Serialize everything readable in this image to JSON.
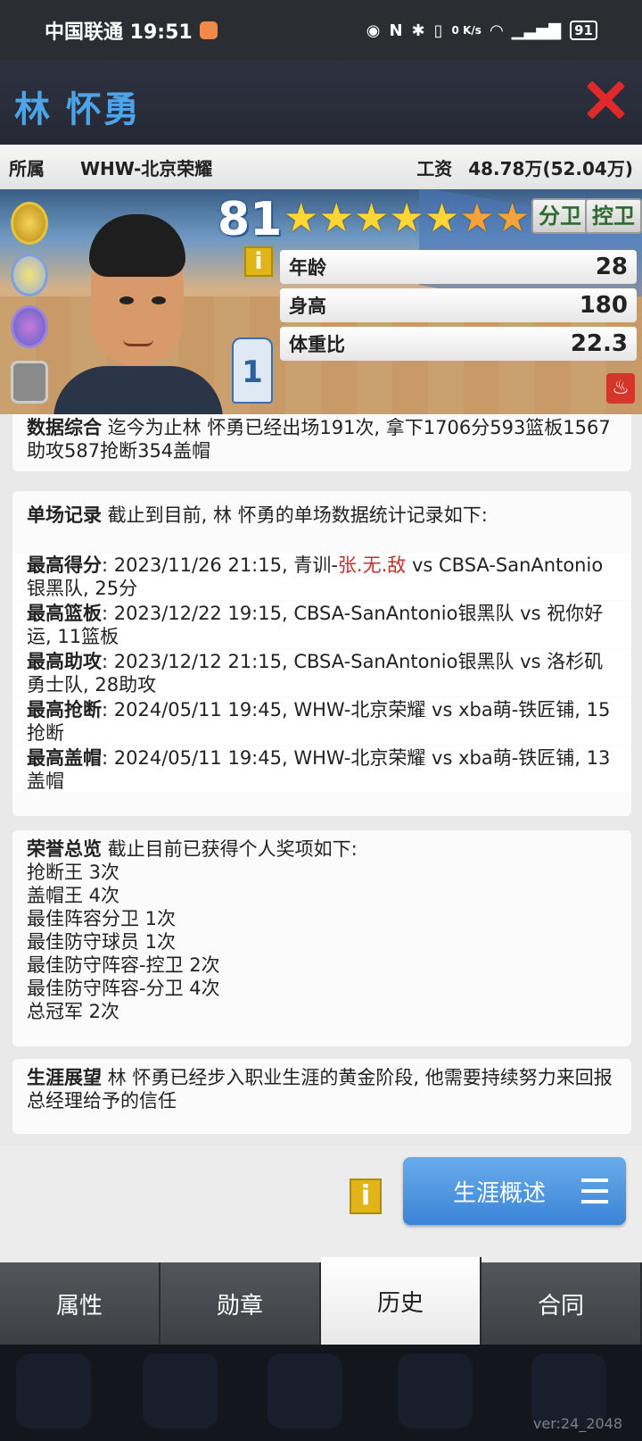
{
  "status_bar": {
    "carrier_time": "中国联通 19:51",
    "net_speed": "0 K/s",
    "battery": "91"
  },
  "header": {
    "player_name": "林 怀勇"
  },
  "team_row": {
    "team_label": "所属",
    "team": "WHW-北京荣耀",
    "salary_label": "工资",
    "salary": "48.78万(52.04万)"
  },
  "hero": {
    "rating": "81",
    "stars": [
      {
        "glyph": "★",
        "color": "gold"
      },
      {
        "glyph": "★",
        "color": "gold"
      },
      {
        "glyph": "★",
        "color": "gold"
      },
      {
        "glyph": "★",
        "color": "gold"
      },
      {
        "glyph": "★",
        "color": "gold"
      },
      {
        "glyph": "★",
        "color": "orange"
      },
      {
        "glyph": "★",
        "color": "orange"
      },
      {
        "glyph": "★",
        "color": "orange"
      }
    ],
    "positions": [
      "分卫",
      "控卫"
    ],
    "info_icon": "i",
    "jersey_number": "1",
    "attributes": [
      {
        "label": "年龄",
        "value": "28"
      },
      {
        "label": "身高",
        "value": "180"
      },
      {
        "label": "体重比",
        "value": "22.3"
      }
    ]
  },
  "summary": {
    "title": "数据综合",
    "text": " 迄今为止林 怀勇已经出场191次, 拿下1706分593篮板1567助攻587抢断354盖帽"
  },
  "records": {
    "title": "单场记录",
    "intro": " 截止到目前, 林 怀勇的单场数据统计记录如下:",
    "items": [
      {
        "label": "最高得分",
        "pre": ": 2023/11/26 21:15, 青训-",
        "highlight": "张.无.敌",
        "post": " vs CBSA-SanAntonio银黑队, 25分"
      },
      {
        "label": "最高篮板",
        "pre": ": 2023/12/22 19:15, CBSA-SanAntonio银黑队 vs 祝你好运, 11篮板",
        "highlight": "",
        "post": ""
      },
      {
        "label": "最高助攻",
        "pre": ": 2023/12/12 21:15, CBSA-SanAntonio银黑队 vs 洛杉矶勇士队, 28助攻",
        "highlight": "",
        "post": ""
      },
      {
        "label": "最高抢断",
        "pre": ": 2024/05/11 19:45, WHW-北京荣耀 vs xba萌-铁匠铺, 15抢断",
        "highlight": "",
        "post": ""
      },
      {
        "label": "最高盖帽",
        "pre": ": 2024/05/11 19:45, WHW-北京荣耀 vs xba萌-铁匠铺, 13盖帽",
        "highlight": "",
        "post": ""
      }
    ]
  },
  "honors": {
    "title": "荣誉总览",
    "intro": " 截止目前已获得个人奖项如下:",
    "items": [
      "抢断王  3次",
      "盖帽王  4次",
      "最佳阵容分卫  1次",
      "最佳防守球员  1次",
      "最佳防守阵容-控卫  2次",
      "最佳防守阵容-分卫  4次",
      "总冠军  2次"
    ]
  },
  "outlook": {
    "title": "生涯展望",
    "text": " 林 怀勇已经步入职业生涯的黄金阶段, 他需要持续努力来回报总经理给予的信任"
  },
  "actions": {
    "info_icon": "i",
    "career_button": "生涯概述"
  },
  "tabs": [
    {
      "label": "属性",
      "active": false
    },
    {
      "label": "勋章",
      "active": false
    },
    {
      "label": "历史",
      "active": true
    },
    {
      "label": "合同",
      "active": false
    }
  ],
  "version": "ver:24_2048"
}
